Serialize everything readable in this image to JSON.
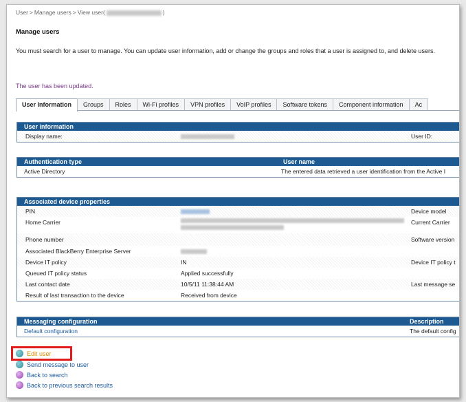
{
  "breadcrumb": {
    "user": "User",
    "manage": "Manage users",
    "view_prefix": "View user",
    "view_suffix": ")"
  },
  "page_title": "Manage users",
  "description": "You must search for a user to manage. You can update user information, add or change the groups and roles that a user is assigned to, and delete users.",
  "status_message": "The user has been updated.",
  "tabs": [
    "User Information",
    "Groups",
    "Roles",
    "Wi-Fi profiles",
    "VPN profiles",
    "VoIP profiles",
    "Software tokens",
    "Component information",
    "Ac"
  ],
  "user_information": {
    "header": "User information",
    "display_name_label": "Display name:",
    "user_id_label": "User ID:"
  },
  "authentication": {
    "col1": "Authentication type",
    "col2": "User name",
    "type": "Active Directory",
    "username": "The entered data retrieved a user identification from the Active I"
  },
  "device_properties": {
    "header": "Associated device properties",
    "rows": [
      {
        "label": "PIN",
        "value": "",
        "right": "Device model"
      },
      {
        "label": "Home Carrier",
        "value": "",
        "right": "Current Carrier"
      },
      {
        "label": "Phone number",
        "value": "",
        "right": "Software version"
      },
      {
        "label": "Associated BlackBerry Enterprise Server",
        "value": "",
        "right": ""
      },
      {
        "label": "Device IT policy",
        "value": "IN",
        "right": "Device IT policy t"
      },
      {
        "label": "Queued IT policy status",
        "value": "Applied successfully",
        "right": ""
      },
      {
        "label": "Last contact date",
        "value": "10/5/11 11:38:44 AM",
        "right": "Last message se"
      },
      {
        "label": "Result of last transaction to the device",
        "value": "Received from device",
        "right": ""
      }
    ]
  },
  "messaging": {
    "header": "Messaging configuration",
    "col2": "Description",
    "config": "Default configuration",
    "description": "The default config"
  },
  "actions": {
    "edit": "Edit user",
    "send": "Send message to user",
    "back": "Back to search",
    "back_prev": "Back to previous search results"
  }
}
